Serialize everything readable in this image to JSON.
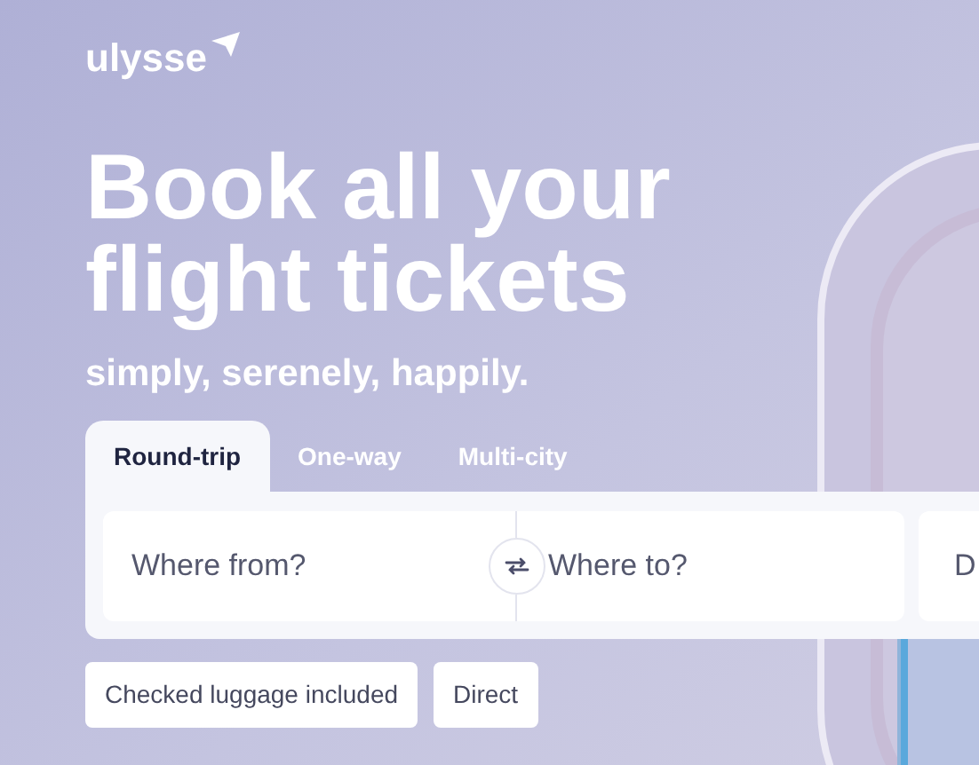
{
  "logo": {
    "text": "ulysse"
  },
  "hero": {
    "title_lines": [
      "Book all your",
      "flight tickets"
    ],
    "subtitle": "simply, serenely, happily."
  },
  "tabs": [
    {
      "label": "Round-trip",
      "selected": true
    },
    {
      "label": "One-way",
      "selected": false
    },
    {
      "label": "Multi-city",
      "selected": false
    }
  ],
  "search": {
    "from": {
      "placeholder": "Where from?"
    },
    "to": {
      "placeholder": "Where to?"
    },
    "date": {
      "placeholder": "D"
    }
  },
  "filters": [
    {
      "label": "Checked luggage included"
    },
    {
      "label": "Direct"
    }
  ]
}
